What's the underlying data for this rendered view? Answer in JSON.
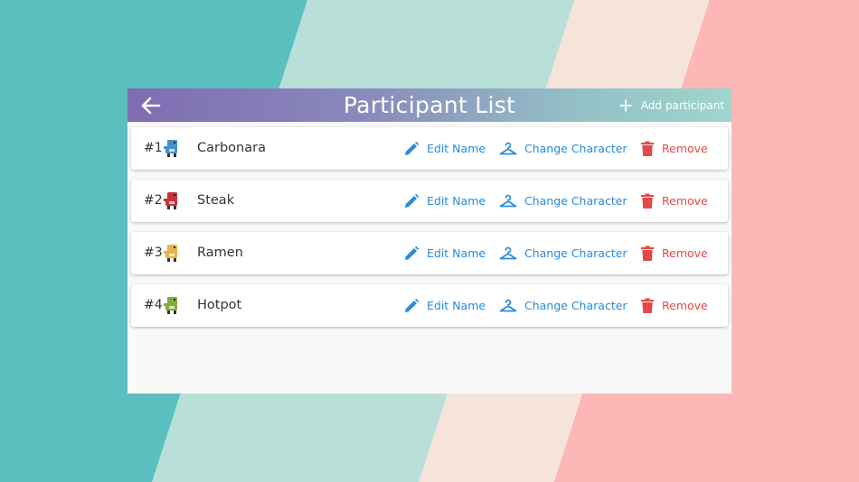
{
  "colors": {
    "accent_blue": "#2c8ad8",
    "danger_red": "#e24a4a",
    "header_gradient_start": "#7f6cb2",
    "header_gradient_end": "#9ed6cc"
  },
  "header": {
    "back_icon": "arrow-left-icon",
    "title": "Participant List",
    "add_icon": "plus-icon",
    "add_label": "Add participant"
  },
  "actions": {
    "edit_label": "Edit Name",
    "edit_icon": "pencil-icon",
    "change_label": "Change Character",
    "change_icon": "hanger-icon",
    "remove_label": "Remove",
    "remove_icon": "trash-icon"
  },
  "participants": [
    {
      "number": "#1",
      "name": "Carbonara",
      "character_color": "#4a8fc9"
    },
    {
      "number": "#2",
      "name": "Steak",
      "character_color": "#c8333a"
    },
    {
      "number": "#3",
      "name": "Ramen",
      "character_color": "#e6b34a"
    },
    {
      "number": "#4",
      "name": "Hotpot",
      "character_color": "#7fae3c"
    }
  ]
}
